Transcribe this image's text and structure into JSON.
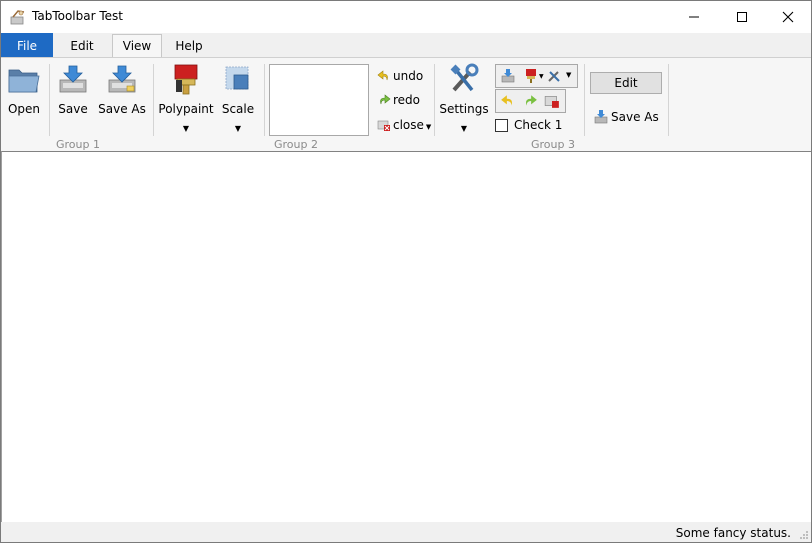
{
  "window": {
    "title": "TabToolbar Test"
  },
  "tabs": [
    {
      "label": "File"
    },
    {
      "label": "Edit"
    },
    {
      "label": "View"
    },
    {
      "label": "Help"
    }
  ],
  "ribbon": {
    "group1": {
      "label": "Group 1",
      "buttons": [
        {
          "label": "Open",
          "icon": "folder-icon"
        },
        {
          "label": "Save",
          "icon": "save-icon"
        },
        {
          "label": "Save As",
          "icon": "save-as-icon"
        }
      ]
    },
    "group2": {
      "label": "Group 2",
      "polypaint": {
        "label": "Polypaint",
        "icon": "paint-bucket-icon"
      },
      "scale": {
        "label": "Scale",
        "icon": "scale-icon"
      },
      "undo": {
        "label": "undo"
      },
      "redo": {
        "label": "redo"
      },
      "close": {
        "label": "close"
      }
    },
    "group3": {
      "label": "Group 3",
      "settings": {
        "label": "Settings",
        "icon": "tools-icon"
      },
      "check1": {
        "label": "Check 1",
        "checked": false
      },
      "edit": {
        "label": "Edit"
      },
      "save_as": {
        "label": "Save As"
      }
    }
  },
  "status": {
    "text": "Some fancy status."
  },
  "colors": {
    "file_tab": "#1e6ac4",
    "accent": "#2f6fb7"
  }
}
